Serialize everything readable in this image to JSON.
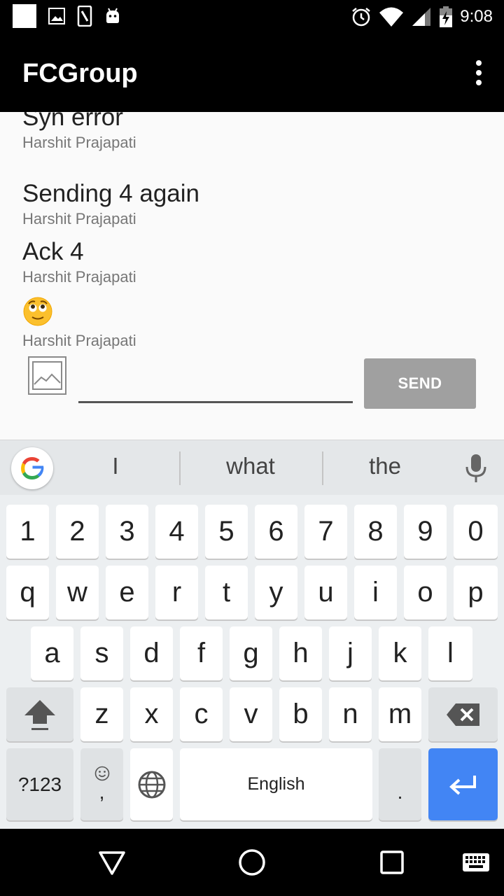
{
  "status_bar": {
    "time": "9:08"
  },
  "app_bar": {
    "title": "FCGroup",
    "menu_icon": "overflow-menu-icon"
  },
  "chat": {
    "messages": [
      {
        "text": "Syn error",
        "sender": "Harshit Prajapati"
      },
      {
        "text": "Sending 4 again",
        "sender": "Harshit Prajapati"
      },
      {
        "text": "Ack 4",
        "sender": "Harshit Prajapati"
      },
      {
        "emoji": "relieved-face-emoji",
        "sender": "Harshit Prajapati"
      }
    ],
    "input_value": "",
    "send_label": "SEND"
  },
  "keyboard": {
    "suggestions": [
      "I",
      "what",
      "the"
    ],
    "row_numbers": [
      "1",
      "2",
      "3",
      "4",
      "5",
      "6",
      "7",
      "8",
      "9",
      "0"
    ],
    "row_top": [
      "q",
      "w",
      "e",
      "r",
      "t",
      "y",
      "u",
      "i",
      "o",
      "p"
    ],
    "row_middle": [
      "a",
      "s",
      "d",
      "f",
      "g",
      "h",
      "j",
      "k",
      "l"
    ],
    "row_bottom": [
      "z",
      "x",
      "c",
      "v",
      "b",
      "n",
      "m"
    ],
    "symbols_label": "?123",
    "comma_label": ",",
    "space_label": "English",
    "period_label": ".",
    "enter_color": "#4285f4"
  }
}
